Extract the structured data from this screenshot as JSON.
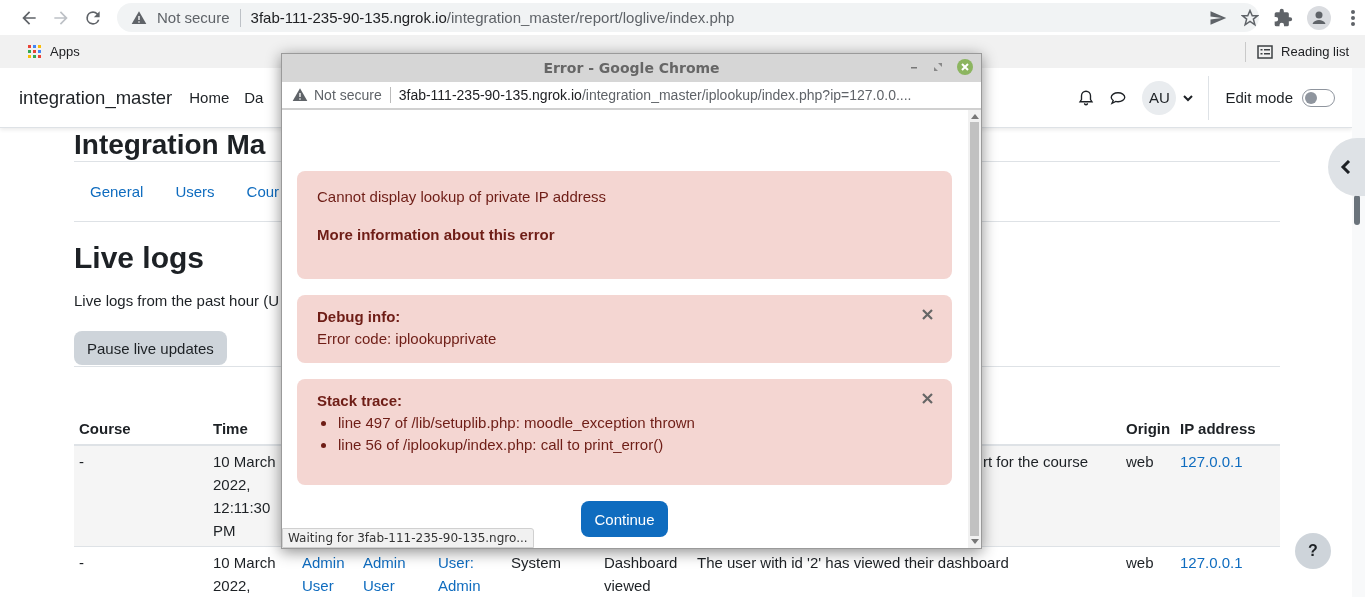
{
  "browser": {
    "not_secure": "Not secure",
    "url_host": "3fab-111-235-90-135.ngrok.io",
    "url_path": "/integration_master/report/loglive/index.php",
    "bookmarks": [
      "Apps"
    ],
    "reading_list": "Reading list"
  },
  "site_nav": {
    "brand": "integration_master",
    "links": [
      "Home",
      "Da"
    ],
    "avatar": "AU",
    "edit_mode": {
      "label": "Edit mode",
      "on": false
    }
  },
  "page": {
    "heading": "Integration Ma",
    "tabs": [
      "General",
      "Users",
      "Cour"
    ],
    "title": "Live logs",
    "intro": "Live logs from the past hour (U",
    "pause_button": "Pause live updates",
    "table": {
      "columns": [
        "Course",
        "Time",
        "Origin",
        "IP address"
      ],
      "rows": [
        {
          "course": "-",
          "time": "10 March 2022, 12:11:30 PM",
          "description_tail": "rt for the course",
          "origin": "web",
          "ip": "127.0.0.1"
        },
        {
          "course": "-",
          "time": "10 March 2022,",
          "user": "Admin User",
          "affected_user": "Admin User",
          "context": "User: Admin",
          "component": "System",
          "event": "Dashboard viewed",
          "description": "The user with id '2' has viewed their dashboard",
          "origin": "web",
          "ip": "127.0.0.1"
        }
      ]
    }
  },
  "help_button": "?",
  "error_window": {
    "title": "Error - Google Chrome",
    "not_secure": "Not secure",
    "url_host": "3fab-111-235-90-135.ngrok.io",
    "url_path": "/integration_master/iplookup/index.php?ip=127.0.0....",
    "alerts": [
      {
        "kind": "message",
        "text": "Cannot display lookup of private IP address",
        "link": "More information about this error",
        "closable": false
      },
      {
        "kind": "debug",
        "heading": "Debug info:",
        "text": "Error code: iplookupprivate",
        "closable": true
      },
      {
        "kind": "trace",
        "heading": "Stack trace:",
        "items": [
          "line 497 of /lib/setuplib.php: moodle_exception thrown",
          "line 56 of /iplookup/index.php: call to print_error()"
        ],
        "closable": true
      }
    ],
    "continue_button": "Continue",
    "status": "Waiting for 3fab-111-235-90-135.ngro..."
  }
}
